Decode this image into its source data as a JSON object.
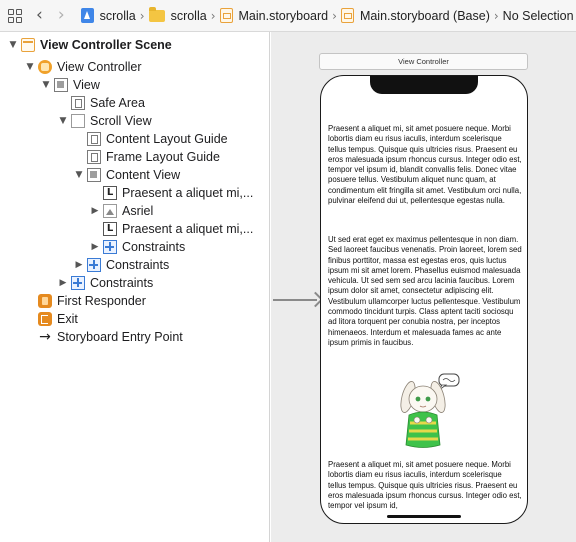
{
  "jumpbar": {
    "icons": [
      "related-items-grid-icon",
      "back-chevron-icon",
      "forward-chevron-icon"
    ],
    "crumbs": [
      {
        "label": "scrolla",
        "icon": "project-icon"
      },
      {
        "label": "scrolla",
        "icon": "folder-icon"
      },
      {
        "label": "Main.storyboard",
        "icon": "storyboard-icon"
      },
      {
        "label": "Main.storyboard (Base)",
        "icon": "storyboard-icon"
      },
      {
        "label": "No Selection",
        "icon": ""
      }
    ]
  },
  "outline": {
    "items": [
      {
        "label": "View Controller Scene",
        "icon": "scene-icon",
        "disclosure": "expanded"
      },
      {
        "label": "View Controller",
        "icon": "view-controller-icon",
        "disclosure": "expanded"
      },
      {
        "label": "View",
        "icon": "view-icon",
        "disclosure": "expanded"
      },
      {
        "label": "Safe Area",
        "icon": "layout-guide-icon",
        "disclosure": "none"
      },
      {
        "label": "Scroll View",
        "icon": "scroll-view-icon",
        "disclosure": "expanded"
      },
      {
        "label": "Content Layout Guide",
        "icon": "layout-guide-icon",
        "disclosure": "none"
      },
      {
        "label": "Frame Layout Guide",
        "icon": "layout-guide-icon",
        "disclosure": "none"
      },
      {
        "label": "Content View",
        "icon": "view-icon",
        "disclosure": "expanded"
      },
      {
        "label": "Praesent a aliquet mi,...",
        "icon": "label-icon",
        "disclosure": "none"
      },
      {
        "label": "Asriel",
        "icon": "image-view-icon",
        "disclosure": "collapsed"
      },
      {
        "label": "Praesent a aliquet mi,...",
        "icon": "label-icon",
        "disclosure": "none"
      },
      {
        "label": "Constraints",
        "icon": "constraints-icon",
        "disclosure": "collapsed"
      },
      {
        "label": "Constraints",
        "icon": "constraints-icon",
        "disclosure": "collapsed"
      },
      {
        "label": "Constraints",
        "icon": "constraints-icon",
        "disclosure": "collapsed"
      },
      {
        "label": "First Responder",
        "icon": "first-responder-icon",
        "disclosure": "none"
      },
      {
        "label": "Exit",
        "icon": "exit-icon",
        "disclosure": "none"
      },
      {
        "label": "Storyboard Entry Point",
        "icon": "entry-arrow-icon",
        "disclosure": "none"
      }
    ]
  },
  "canvas": {
    "scene_title": "View Controller",
    "paragraph_1": "Praesent a aliquet mi, sit amet posuere neque. Morbi lobortis diam eu risus iaculis, interdum scelerisque tellus tempus. Quisque quis ultricies risus. Praesent eu eros malesuada ipsum rhoncus cursus. Integer odio est, tempor vel ipsum id, blandit convallis felis. Donec vitae posuere tellus. Vestibulum aliquet nunc quam, at condimentum elit fringilla sit amet. Vestibulum orci nulla, pulvinar eleifend dui ut, pellentesque egestas nulla.",
    "paragraph_2": "Ut sed erat eget ex maximus pellentesque in non diam. Sed laoreet faucibus venenatis. Proin laoreet, lorem sed finibus porttitor, massa est egestas eros, quis luctus ipsum mi sit amet lorem. Phasellus euismod malesuada vehicula. Ut sed sem sed arcu lacinia faucibus. Lorem ipsum dolor sit amet, consectetur adipiscing elit. Vestibulum ullamcorper luctus pellentesque. Vestibulum commodo tincidunt turpis. Class aptent taciti sociosqu ad litora torquent per conubia nostra, per inceptos himenaeos. Interdum et malesuada fames ac ante ipsum primis in faucibus.",
    "paragraph_3": "Praesent a aliquet mi, sit amet posuere neque. Morbi lobortis diam eu risus iaculis, interdum scelerisque tellus tempus. Quisque quis ultricies risus. Praesent eu eros malesuada ipsum rhoncus cursus. Integer odio est, tempor vel ipsum id,",
    "image_alt": "asriel-illustration"
  }
}
